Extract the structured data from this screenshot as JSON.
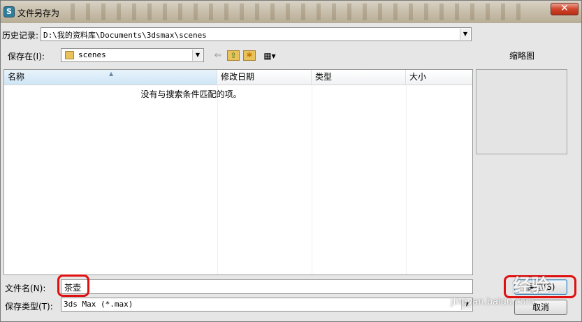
{
  "window": {
    "title": "文件另存为",
    "close_glyph": "✕"
  },
  "history": {
    "label": "历史记录:",
    "value": "D:\\我的资料库\\Documents\\3dsmax\\scenes"
  },
  "save_in": {
    "label": "保存在(I):",
    "value": "scenes"
  },
  "toolbar": {
    "back_glyph": "⇐",
    "up_glyph": "⇧",
    "new_folder_glyph": "✱",
    "view_glyph": "▦▾"
  },
  "file_list": {
    "columns": [
      "名称",
      "修改日期",
      "类型",
      "大小"
    ],
    "empty_message": "没有与搜索条件匹配的项。"
  },
  "thumbnail": {
    "label": "缩略图"
  },
  "filename": {
    "label": "文件名(N):",
    "value": "茶壶"
  },
  "filetype": {
    "label": "保存类型(T):",
    "value": "3ds Max (*.max)"
  },
  "buttons": {
    "save": "保存(S)",
    "cancel": "取消"
  },
  "watermark": {
    "logo": "经验",
    "url": "jingyan.baidu.com"
  },
  "colors": {
    "highlight": "#e01010",
    "sorted_header": "#cfe6f6"
  }
}
